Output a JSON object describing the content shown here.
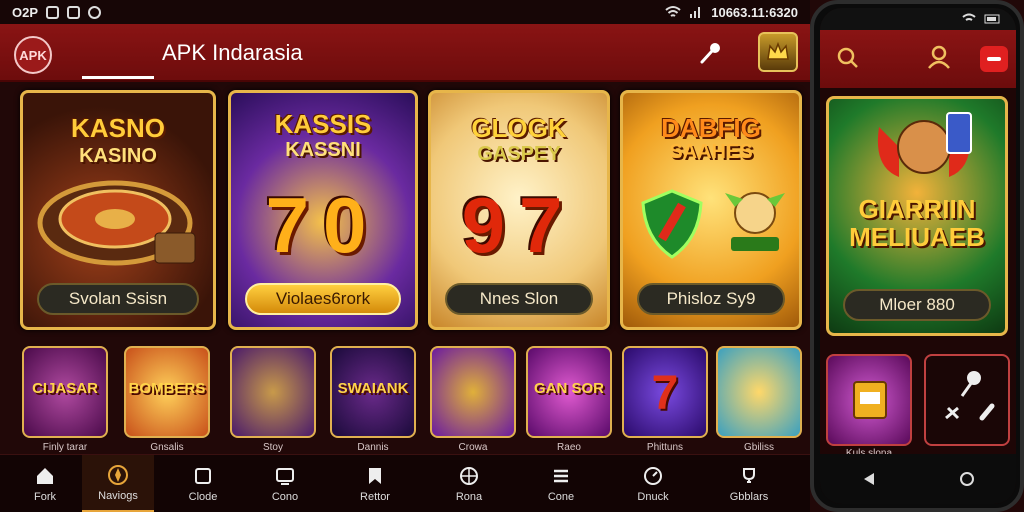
{
  "status_bar": {
    "left_text": "O2P",
    "time_text": "10663.11:6320"
  },
  "header": {
    "logo_text": "APK",
    "title": "APK Indarasia"
  },
  "cards": [
    {
      "title": "KASNO",
      "subtitle": "KASINO",
      "digits": "",
      "button": "Svolan Ssisn",
      "button_style": "dark"
    },
    {
      "title": "KASSIS",
      "subtitle": "KASSNI",
      "digits": "70",
      "button": "Violaes6rork",
      "button_style": "gold"
    },
    {
      "title": "GLOGK",
      "subtitle": "GASPEY",
      "digits": "97",
      "button": "Nnes Slon",
      "button_style": "dark"
    },
    {
      "title": "DABFIG",
      "subtitle": "SAAHES",
      "digits": "",
      "button": "Phisloz Sy9",
      "button_style": "dark"
    }
  ],
  "tiles": [
    {
      "label": "CIJASAR",
      "caption": "Finly tarar"
    },
    {
      "label": "BOMBERS",
      "caption": "Gnsalis"
    },
    {
      "label": "",
      "caption": "Stoy"
    },
    {
      "label": "SWAIANK",
      "caption": "Dannis"
    },
    {
      "label": "",
      "caption": "Crowa"
    },
    {
      "label": "GAN SOR",
      "caption": "Raeo"
    },
    {
      "label": "7",
      "caption": "Phittuns"
    },
    {
      "label": "",
      "caption": "Gbiliss"
    }
  ],
  "bottom_nav": [
    {
      "label": "Fork",
      "icon": "home-icon"
    },
    {
      "label": "Naviogs",
      "icon": "compass-icon",
      "active": true
    },
    {
      "label": "Clode",
      "icon": "card-icon"
    },
    {
      "label": "Cono",
      "icon": "tv-icon"
    },
    {
      "label": "Rettor",
      "icon": "bookmark-icon"
    },
    {
      "label": "Rona",
      "icon": "chip-icon"
    },
    {
      "label": "Cone",
      "icon": "menu-icon"
    },
    {
      "label": "Dnuck",
      "icon": "gauge-icon"
    },
    {
      "label": "Gbblars",
      "icon": "trophy-icon"
    }
  ],
  "phone": {
    "card_title": "GIARRIIN MELIUAEB",
    "card_button": "Mloer 880",
    "tile_caption": "Kuls slona"
  },
  "colors": {
    "accent_gold": "#e7b64a",
    "header_red": "#8a1414",
    "background": "#210808"
  }
}
